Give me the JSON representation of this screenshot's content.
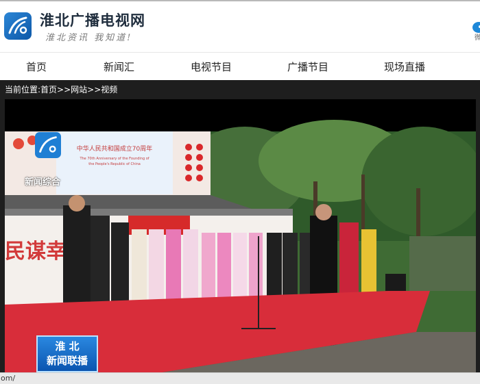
{
  "header": {
    "site_title": "淮北广播电视网",
    "slogan": "淮北资讯 我知道!",
    "weibo_label": "微"
  },
  "nav": {
    "items": [
      "首页",
      "新闻汇",
      "电视节目",
      "广播节目",
      "现场直播"
    ]
  },
  "breadcrumb": "当前位置:首页>>网站>>视频",
  "video": {
    "banner_line1": "中华人民共和国成立70周年",
    "banner_line2": "The 70th Anniversary of the Founding of",
    "banner_line3": "the People's Republic of China",
    "wall_text": "民谋幸",
    "overlay_label": "新闻综合",
    "caption_line1": "淮 北",
    "caption_line2": "新闻联播"
  },
  "statusbar": {
    "text": "om/"
  }
}
